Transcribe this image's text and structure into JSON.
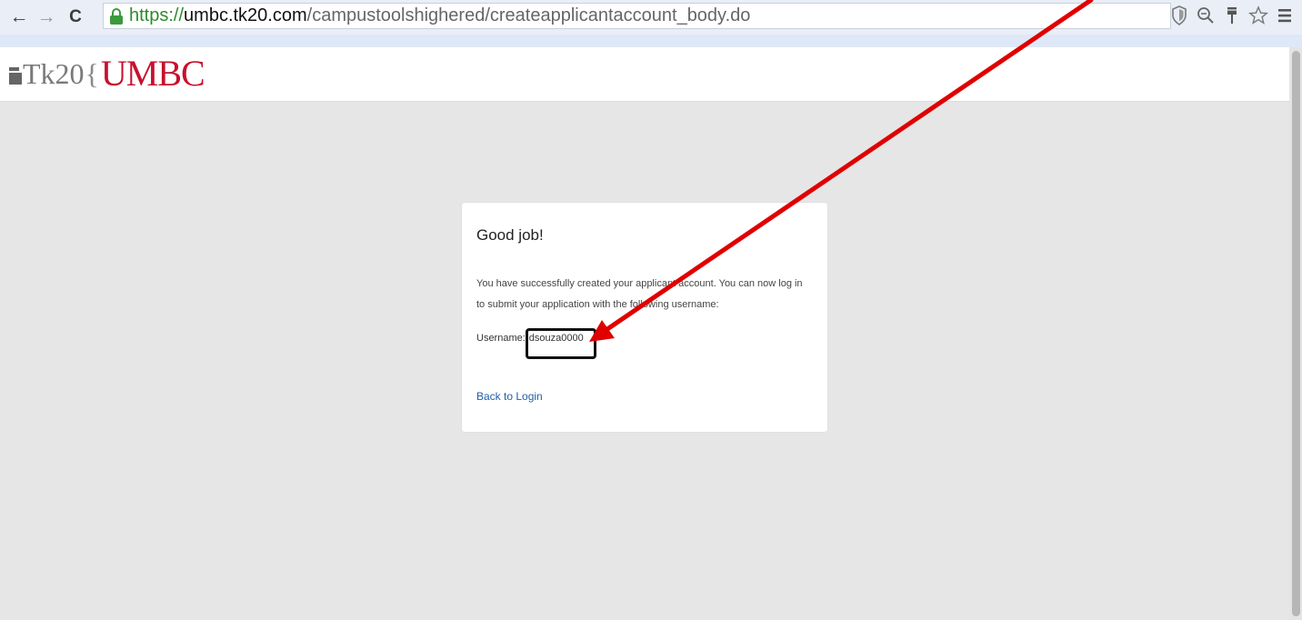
{
  "browser": {
    "back_glyph": "←",
    "forward_glyph": "→",
    "reload_glyph": "C",
    "url_scheme": "https://",
    "url_host": "umbc.tk20.com",
    "url_path": "/campustoolshighered/createapplicantaccount_body.do",
    "ext_icons": [
      "shield-icon",
      "zoom-icon",
      "pin-icon",
      "star-icon",
      "menu-icon"
    ]
  },
  "header": {
    "logo_tk": "Tk20",
    "logo_brace": "{",
    "logo_umbc": "UMBC"
  },
  "card": {
    "title": "Good job!",
    "message": "You have successfully created your applicant account. You can now log in to submit your application with the following username:",
    "username_label": "Username:",
    "username_value": "dsouza0000",
    "back_link": "Back to Login"
  },
  "colors": {
    "umbc_red": "#c8102e",
    "annotation_arrow": "#e00000",
    "link_blue": "#1f5fa8"
  }
}
